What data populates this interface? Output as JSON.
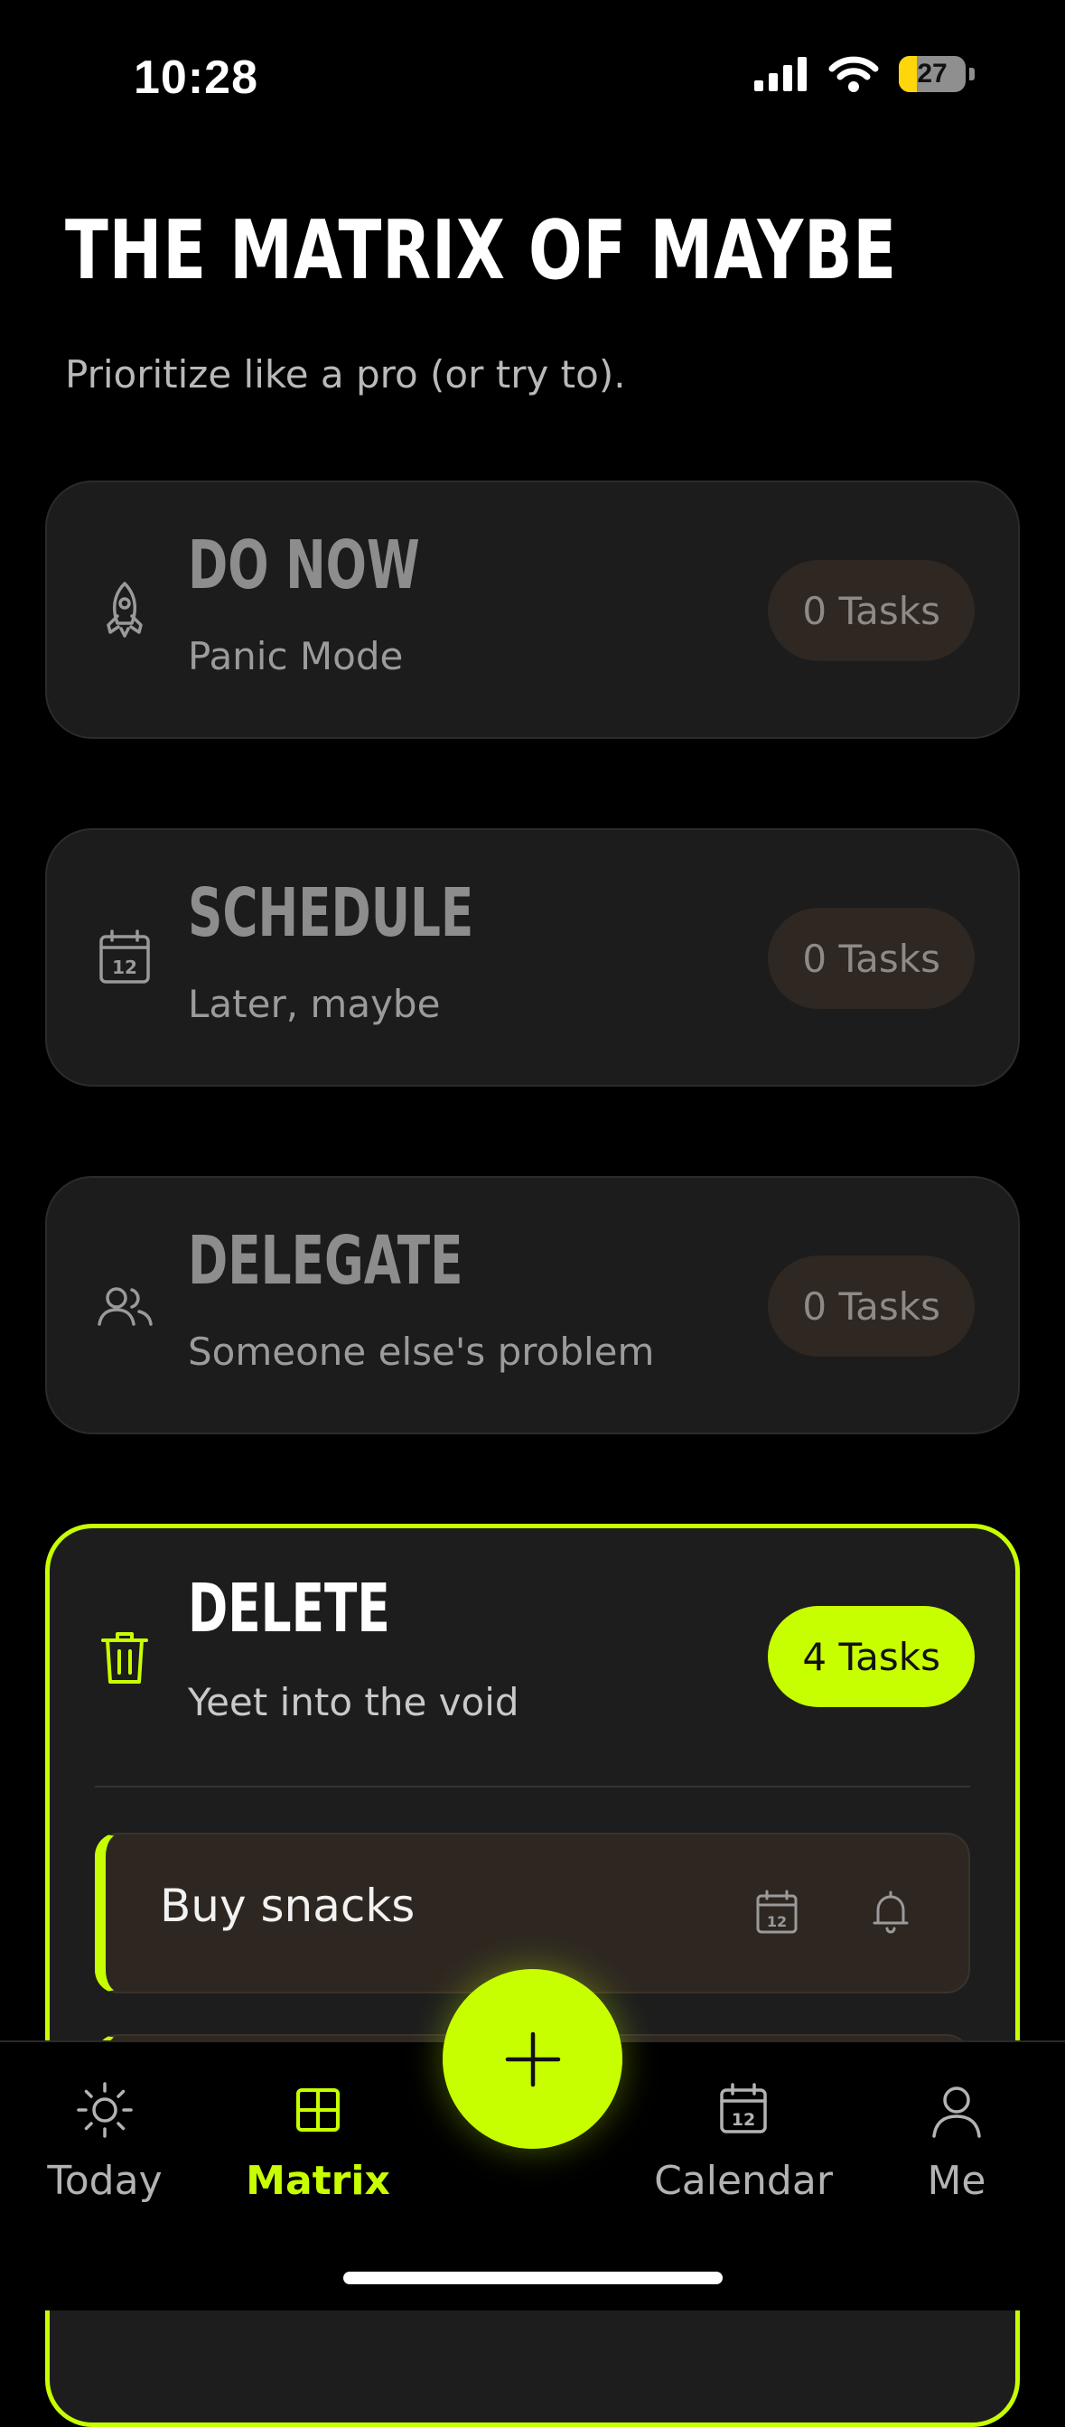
{
  "status_bar": {
    "time": "10:28",
    "battery": "27",
    "battery_level": 0.27
  },
  "header": {
    "title": "THE MATRIX OF MAYBE",
    "subtitle": "Prioritize like a pro (or try to)."
  },
  "quadrants": [
    {
      "title": "DO NOW",
      "subtitle": "Panic Mode",
      "badge": "0 Tasks",
      "icon": "rocket-icon"
    },
    {
      "title": "SCHEDULE",
      "subtitle": "Later, maybe",
      "badge": "0 Tasks",
      "icon": "calendar-icon"
    },
    {
      "title": "DELEGATE",
      "subtitle": "Someone else's problem",
      "badge": "0 Tasks",
      "icon": "users-icon"
    },
    {
      "title": "DELETE",
      "subtitle": "Yeet into the void",
      "badge": "4 Tasks",
      "icon": "trash-icon"
    }
  ],
  "delete_tasks": [
    {
      "label": "Buy snacks"
    },
    {
      "label": ""
    }
  ],
  "tabs": [
    {
      "label": "Today",
      "icon": "sun-icon"
    },
    {
      "label": "Matrix",
      "icon": "grid-icon",
      "active": true
    },
    {
      "label": "Calendar",
      "icon": "calendar-icon"
    },
    {
      "label": "Me",
      "icon": "user-icon"
    }
  ],
  "fab": {
    "icon": "plus-icon"
  },
  "colors": {
    "accent": "#c8ff00",
    "background": "#000000",
    "card": "#1c1c1c",
    "badge_muted": "#2e2722"
  }
}
